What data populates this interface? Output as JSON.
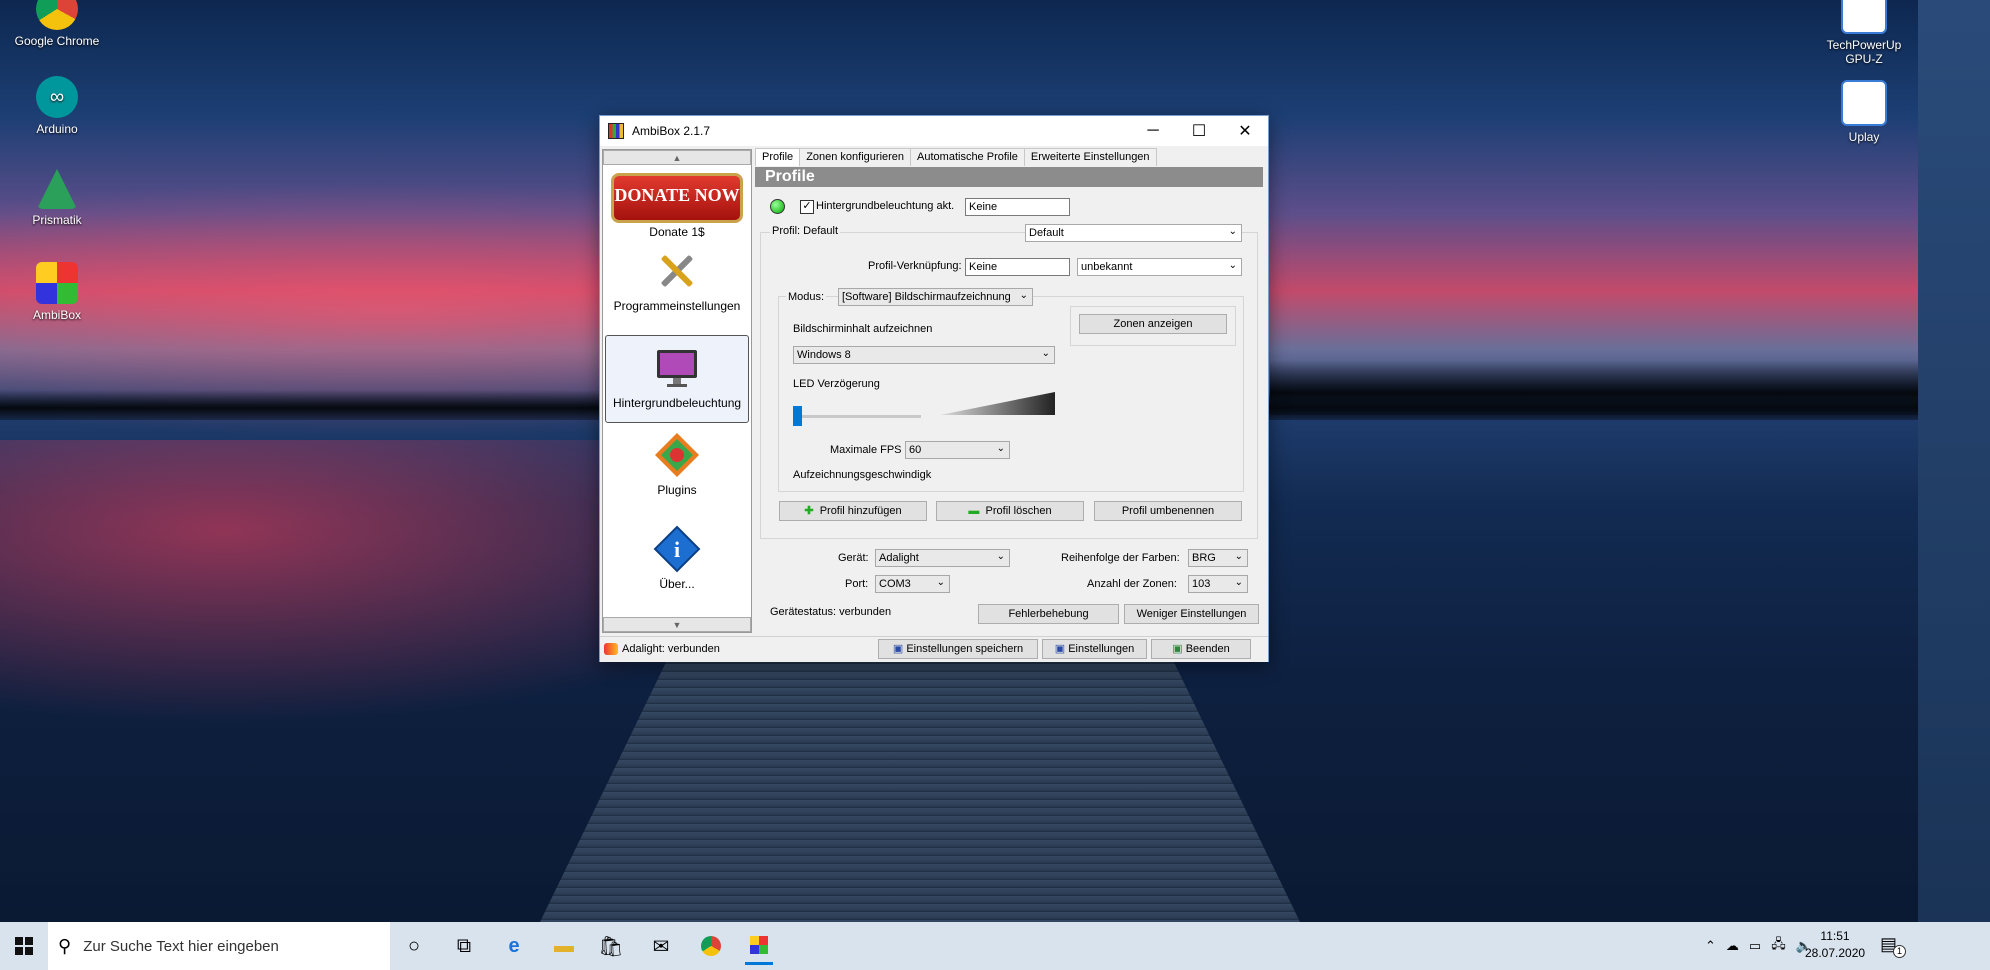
{
  "desktop": {
    "icons_left": [
      {
        "label": "Google Chrome"
      },
      {
        "label": "Arduino"
      },
      {
        "label": "Prismatik"
      },
      {
        "label": "AmbiBox"
      }
    ],
    "icons_right": [
      {
        "label": "TechPowerUp GPU-Z"
      },
      {
        "label": "Uplay"
      }
    ]
  },
  "window": {
    "title": "AmbiBox 2.1.7",
    "controls": {
      "minimize": "─",
      "maximize": "☐",
      "close": "✕"
    },
    "sidebar": {
      "donate_banner": "DONATE NOW",
      "donate_label": "Donate 1$",
      "items": [
        {
          "label": "Programmeinstellungen",
          "icon": "tools-icon"
        },
        {
          "label": "Hintergrundbeleuchtung",
          "icon": "monitor-icon",
          "selected": true
        },
        {
          "label": "Plugins",
          "icon": "puzzle-icon"
        },
        {
          "label": "Über...",
          "icon": "info-icon"
        }
      ]
    },
    "tabs": [
      "Profile",
      "Zonen konfigurieren",
      "Automatische Profile",
      "Erweiterte Einstellungen"
    ],
    "active_tab": "Profile",
    "section_title": "Profile",
    "backlight_checkbox_label": "Hintergrundbeleuchtung akt.",
    "backlight_checked": true,
    "backlight_hotkey": "Keine",
    "profile_group_label": "Profil: Default",
    "profile_select": "Default",
    "profile_link_label": "Profil-Verknüpfung:",
    "profile_link_value": "Keine",
    "profile_link_select": "unbekannt",
    "mode_label": "Modus:",
    "mode_select": "[Software] Bildschirmaufzeichnung",
    "zones_button": "Zonen anzeigen",
    "capture_label": "Bildschirminhalt aufzeichnen",
    "capture_select": "Windows 8",
    "led_delay_label": "LED Verzögerung",
    "led_delay_level": 0,
    "max_fps_label": "Maximale FPS",
    "max_fps_value": "60",
    "capture_speed_label": "Aufzeichnungsgeschwindigk",
    "add_profile": "Profil hinzufügen",
    "delete_profile": "Profil löschen",
    "rename_profile": "Profil umbenennen",
    "device_label": "Gerät:",
    "device_value": "Adalight",
    "port_label": "Port:",
    "port_value": "COM3",
    "color_order_label": "Reihenfolge der Farben:",
    "color_order_value": "BRG",
    "zones_count_label": "Anzahl der Zonen:",
    "zones_count_value": "103",
    "device_status": "Gerätestatus: verbunden",
    "troubleshoot_button": "Fehlerbehebung",
    "less_settings_button": "Weniger Einstellungen",
    "statusbar": {
      "status": "Adalight: verbunden",
      "save": "Einstellungen speichern",
      "settings": "Einstellungen",
      "quit": "Beenden"
    }
  },
  "taskbar": {
    "search_placeholder": "Zur Suche Text hier eingeben",
    "time": "11:51",
    "date": "28.07.2020",
    "notification_count": "1"
  },
  "colors": {
    "accent": "#0078d7",
    "section_header": "#8c8c8c",
    "donate_red": "#c8231b"
  }
}
